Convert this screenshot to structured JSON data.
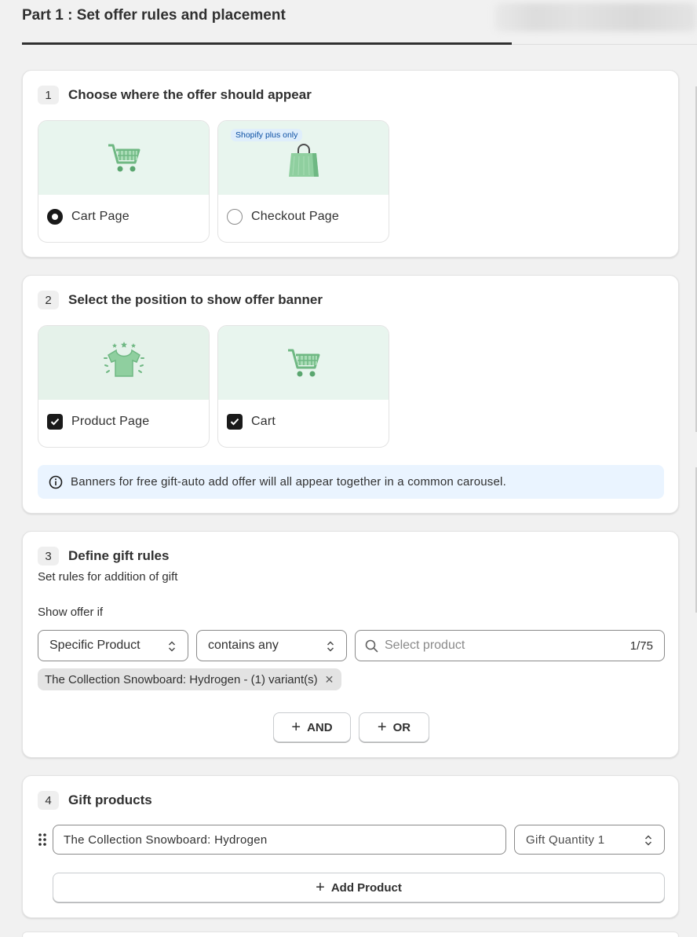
{
  "header": {
    "title": "Part 1 : Set offer rules and placement"
  },
  "section1": {
    "number": "1",
    "title": "Choose where the offer should appear",
    "options": [
      {
        "label": "Cart Page",
        "selected": true,
        "icon": "cart-icon"
      },
      {
        "label": "Checkout Page",
        "selected": false,
        "badge": "Shopify plus only",
        "icon": "shopping-bag-icon"
      }
    ]
  },
  "section2": {
    "number": "2",
    "title": "Select the position to show offer banner",
    "options": [
      {
        "label": "Product Page",
        "checked": true,
        "icon": "tshirt-icon"
      },
      {
        "label": "Cart",
        "checked": true,
        "icon": "cart-icon"
      }
    ],
    "info": "Banners for free gift-auto add offer will all appear together in a common carousel."
  },
  "section3": {
    "number": "3",
    "title": "Define gift rules",
    "subtitle": "Set rules for addition of gift",
    "show_offer_label": "Show offer if",
    "condition_type": "Specific Product",
    "operator": "contains any",
    "search_placeholder": "Select product",
    "counter": "1/75",
    "selected_tag": "The Collection Snowboard: Hydrogen - (1) variant(s)",
    "and_label": "AND",
    "or_label": "OR"
  },
  "section4": {
    "number": "4",
    "title": "Gift products",
    "product_name": "The Collection Snowboard: Hydrogen",
    "quantity_label": "Gift Quantity 1",
    "add_product_label": "Add Product"
  },
  "colors": {
    "accent_dark": "#1a1a1a",
    "icon_green": "#7dc28f",
    "info_bg": "#eaf4ff",
    "badge_text": "#0b4fa3"
  }
}
